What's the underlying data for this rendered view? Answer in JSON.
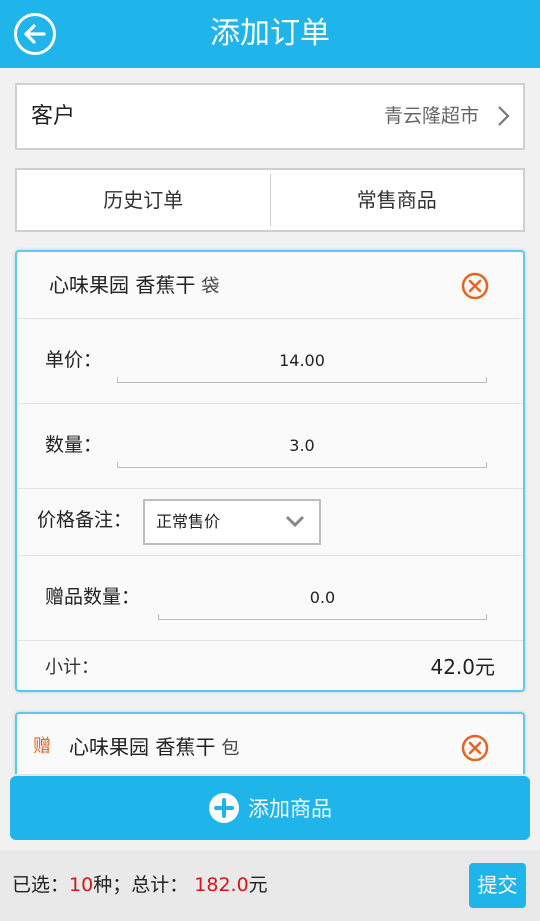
{
  "header": {
    "title": "添加订单",
    "back_icon": "back-arrow-icon"
  },
  "customer": {
    "label": "客户",
    "value": "青云隆超市"
  },
  "tabs": [
    {
      "label": "历史订单"
    },
    {
      "label": "常售商品"
    }
  ],
  "items": [
    {
      "name": "心味果园 香蕉干",
      "unit": "袋",
      "price_label": "单价：",
      "price": "14.00",
      "qty_label": "数量：",
      "qty": "3.0",
      "note_label": "价格备注：",
      "note_value": "正常售价",
      "gift_label": "赠品数量：",
      "gift_qty": "0.0",
      "subtotal_label": "小计：",
      "subtotal": "42.0元"
    },
    {
      "tag": "赠",
      "name": "心味果园 香蕉干",
      "unit": "包"
    }
  ],
  "add_button": {
    "label": "添加商品"
  },
  "summary": {
    "selected_prefix": "已选：",
    "selected_count": "10",
    "selected_suffix": "种；总计：",
    "total": "182.0",
    "currency": "元"
  },
  "submit": {
    "label": "提交"
  },
  "colors": {
    "primary": "#1fb5ea",
    "danger": "#e8641e",
    "highlight": "#d41616"
  }
}
